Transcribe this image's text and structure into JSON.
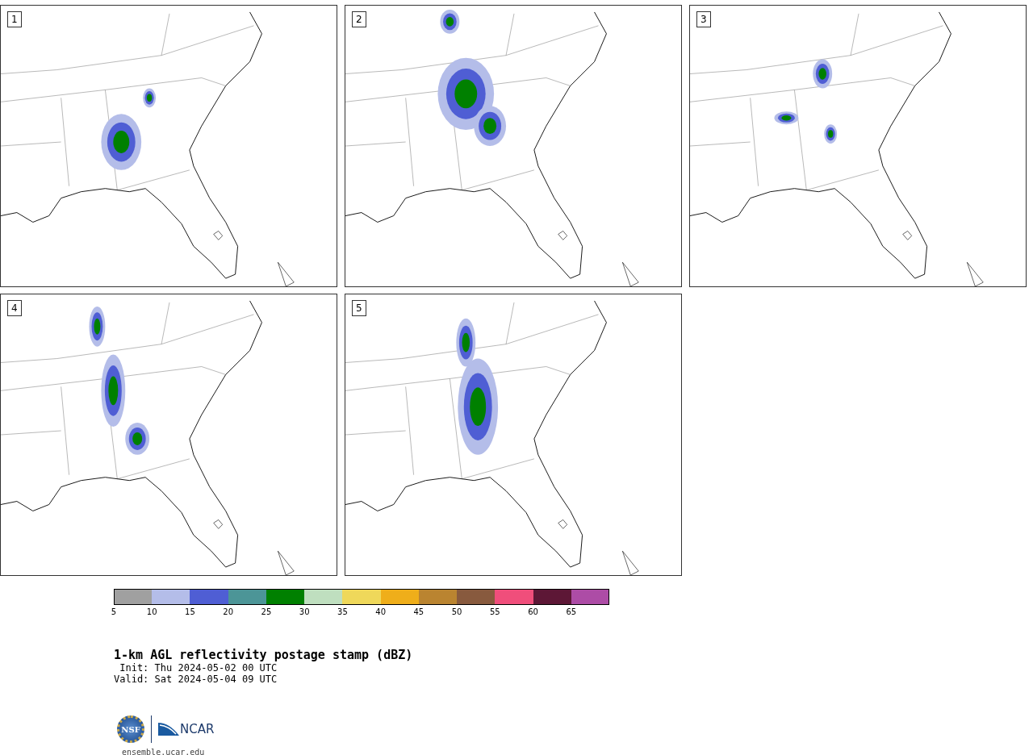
{
  "panels": [
    {
      "label": "1"
    },
    {
      "label": "2"
    },
    {
      "label": "3"
    },
    {
      "label": "4"
    },
    {
      "label": "5"
    }
  ],
  "colorbar": {
    "segments": [
      {
        "color": "#a0a0a0"
      },
      {
        "color": "#b4bde9"
      },
      {
        "color": "#4f5ed4"
      },
      {
        "color": "#4c9597"
      },
      {
        "color": "#008000"
      },
      {
        "color": "#bfdfbf"
      },
      {
        "color": "#efd85a"
      },
      {
        "color": "#efae1a"
      },
      {
        "color": "#ba8430"
      },
      {
        "color": "#885a3e"
      },
      {
        "color": "#f04e7b"
      },
      {
        "color": "#5d1736"
      },
      {
        "color": "#ad4ca6"
      }
    ],
    "ticks": [
      "5",
      "10",
      "15",
      "20",
      "25",
      "30",
      "35",
      "40",
      "45",
      "50",
      "55",
      "60",
      "65"
    ]
  },
  "title": "1-km AGL reflectivity postage stamp (dBZ)",
  "init": " Init: Thu 2024-05-02 00 UTC",
  "valid": "Valid: Sat 2024-05-04 09 UTC",
  "logos": {
    "nsf": "NSF",
    "ncar": "NCAR"
  },
  "footer": "ensemble.ucar.edu"
}
